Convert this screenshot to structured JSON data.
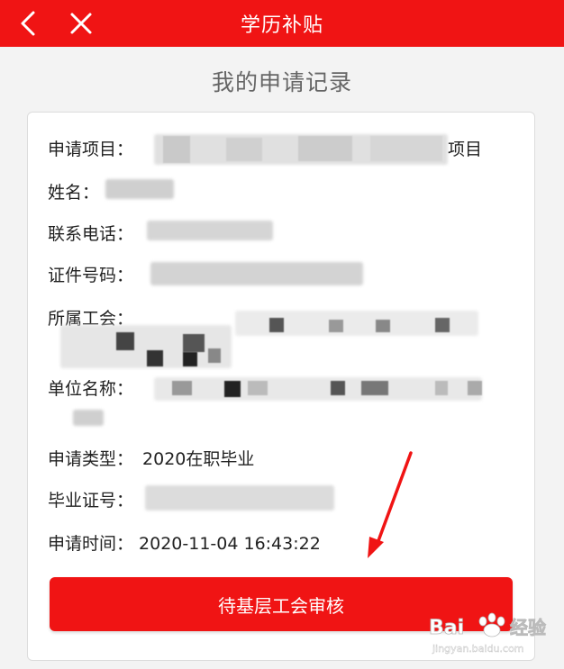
{
  "header": {
    "title": "学历补贴",
    "back_icon": "chevron-left-icon",
    "close_icon": "close-icon"
  },
  "page_title": "我的申请记录",
  "fields": [
    {
      "label": "申请项目：",
      "value": "项目"
    },
    {
      "label": "姓名：",
      "value": ""
    },
    {
      "label": "联系电话：",
      "value": ""
    },
    {
      "label": "证件号码：",
      "value": ""
    },
    {
      "label": "所属工会：",
      "value": ""
    },
    {
      "label": "单位名称：",
      "value": ""
    },
    {
      "label": "申请类型：",
      "value": "2020在职毕业"
    },
    {
      "label": "毕业证号：",
      "value": ""
    },
    {
      "label": "申请时间：",
      "value": "2020-11-04 16:43:22"
    }
  ],
  "status_button": {
    "label": "待基层工会审核"
  },
  "watermark": {
    "brand": "Bai",
    "brand2": "经验",
    "url": "jingyan.baidu.com"
  },
  "colors": {
    "brand_red": "#f01414",
    "subtitle": "#666666",
    "text": "#222222"
  }
}
